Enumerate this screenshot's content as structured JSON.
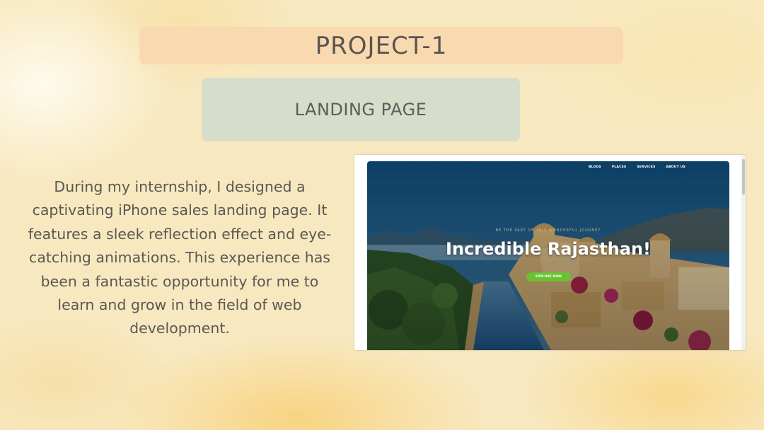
{
  "slide": {
    "title": "PROJECT-1",
    "subtitle": "LANDING PAGE",
    "description": "During my internship, I designed a captivating iPhone sales landing page. It features a sleek reflection effect and eye-catching animations. This experience has been a fantastic opportunity for me to learn and grow in the field of web development."
  },
  "preview": {
    "nav": [
      "BLOGS",
      "PLACES",
      "SERVICES",
      "ABOUT US"
    ],
    "tagline": "BE THE PART OF THIS WONDERFUL JOURNEY",
    "hero_title": "Incredible Rajasthan!",
    "cta_label": "EXPLORE NOW"
  },
  "colors": {
    "title_box": "#f9d9b0",
    "subtitle_box": "#d6ddca",
    "cta_green": "#6cc034",
    "sky": "#1b4f78"
  }
}
